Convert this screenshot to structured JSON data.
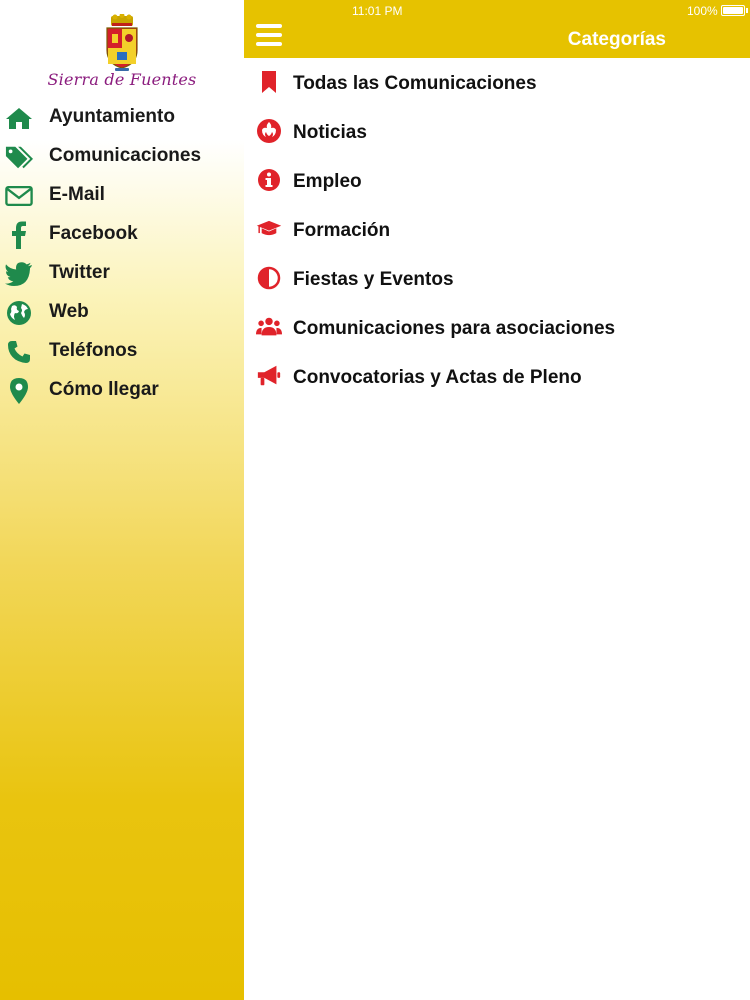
{
  "status_bar": {
    "time": "11:01 PM",
    "battery": "100%",
    "battery_level": 1.0
  },
  "header": {
    "title": "Categorías",
    "menu_icon": "hamburger-icon"
  },
  "sidebar": {
    "logo_text": "Sierra de Fuentes",
    "items": [
      {
        "label": "Ayuntamiento",
        "icon": "home-icon"
      },
      {
        "label": "Comunicaciones",
        "icon": "tags-icon"
      },
      {
        "label": "E-Mail",
        "icon": "envelope-icon"
      },
      {
        "label": "Facebook",
        "icon": "facebook-icon"
      },
      {
        "label": "Twitter",
        "icon": "twitter-icon"
      },
      {
        "label": "Web",
        "icon": "globe-icon"
      },
      {
        "label": "Teléfonos",
        "icon": "phone-icon"
      },
      {
        "label": "Cómo llegar",
        "icon": "map-marker-icon"
      }
    ],
    "icon_color": "#1f8a4c"
  },
  "categories": {
    "icon_color": "#e0232a",
    "items": [
      {
        "label": "Todas las Comunicaciones",
        "icon": "bookmark-icon"
      },
      {
        "label": "Noticias",
        "icon": "rebel-icon"
      },
      {
        "label": "Empleo",
        "icon": "info-circle-icon"
      },
      {
        "label": "Formación",
        "icon": "graduation-cap-icon"
      },
      {
        "label": "Fiestas y Eventos",
        "icon": "adjust-icon"
      },
      {
        "label": "Comunicaciones para asociaciones",
        "icon": "users-icon"
      },
      {
        "label": "Convocatorias y Actas de Pleno",
        "icon": "bullhorn-icon"
      }
    ]
  },
  "colors": {
    "header_yellow": "#e6c200",
    "sidebar_green": "#1f8a4c",
    "category_red": "#e0232a"
  }
}
